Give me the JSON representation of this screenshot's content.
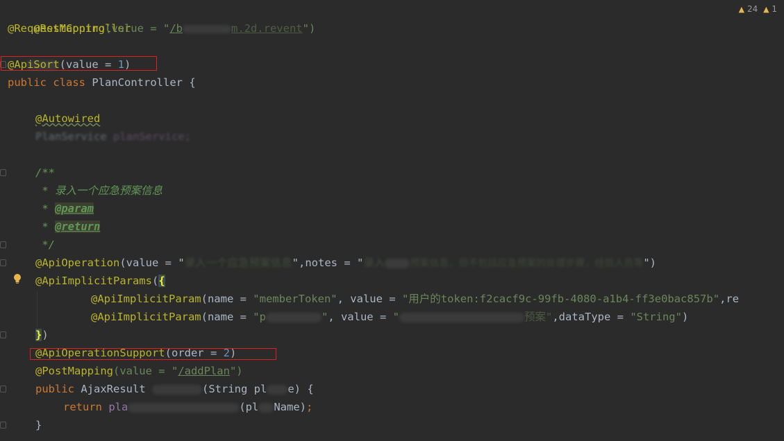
{
  "warnings": {
    "icon": "warning-triangle-icon",
    "count": "24",
    "extra": "1"
  },
  "code": {
    "l1_annotation": "@RestController",
    "l2_annotation": "@RequestMapping",
    "l2_args_open": "(value = \"",
    "l2_path_visible": "/b",
    "l2_path_tail": "m.2d.revent",
    "l2_args_close": "\")",
    "l4_annotation": "@ApiSort",
    "l4_args_open": "(value = ",
    "l4_value": "1",
    "l4_args_close": ")",
    "l5_kw1": "public",
    "l5_kw2": "class",
    "l5_name": "PlanController {",
    "l7_annotation": "@Autowired",
    "l8_type": "PlanService",
    "l8_field": "planService;",
    "l10_comment": "/**",
    "l11_comment": " * 录入一个应急预案信息",
    "l12_star": " * ",
    "l12_tag": "@param",
    "l13_star": " * ",
    "l13_tag": "@return",
    "l14_comment": " */",
    "l15_annotation": "@ApiOperation",
    "l15_a": "(value = \"",
    "l15_v1": "录入一个应急预案信息",
    "l15_b": "\",notes = \"",
    "l15_v2": "录入",
    "l15_v3": "预案信息，但不包括应急预案的处理步骤，经验人员等",
    "l15_c": "\")",
    "l16_annotation": "@ApiImplicitParams",
    "l16_paren": "(",
    "l16_brace": "{",
    "l17_annotation": "@ApiImplicitParam",
    "l17_a": "(name = ",
    "l17_s1": "\"memberToken\"",
    "l17_b": ", value = ",
    "l17_s2": "\"用户的token:f2cacf9c-99fb-4080-a1b4-ff3e0bac857b\"",
    "l17_c": ",re",
    "l18_annotation": "@ApiImplicitParam",
    "l18_a": "(name = ",
    "l18_s1": "\"p",
    "l18_s1b": "\"",
    "l18_b": ", value = ",
    "l18_s2": "\"",
    "l18_s2b": "预案\"",
    "l18_c": ",dataType = ",
    "l18_s3": "\"String\"",
    "l18_d": ")",
    "l19_brace": "}",
    "l19_paren": ")",
    "l20_annotation": "@ApiOperationSupport",
    "l20_a": "(order = ",
    "l20_value": "2",
    "l20_b": ")",
    "l21_annotation": "@PostMapping",
    "l21_a": "(value = \"",
    "l21_path": "/addPlan",
    "l21_b": "\")",
    "l22_kw": "public",
    "l22_type": "AjaxResult ",
    "l22_params": "(String pl",
    "l22_params_b": "e) {",
    "l23_kw": "return",
    "l23_a": "pla",
    "l23_b": "(pl",
    "l23_c": "Name)",
    "l23_semi": ";",
    "l24_brace": "}"
  }
}
